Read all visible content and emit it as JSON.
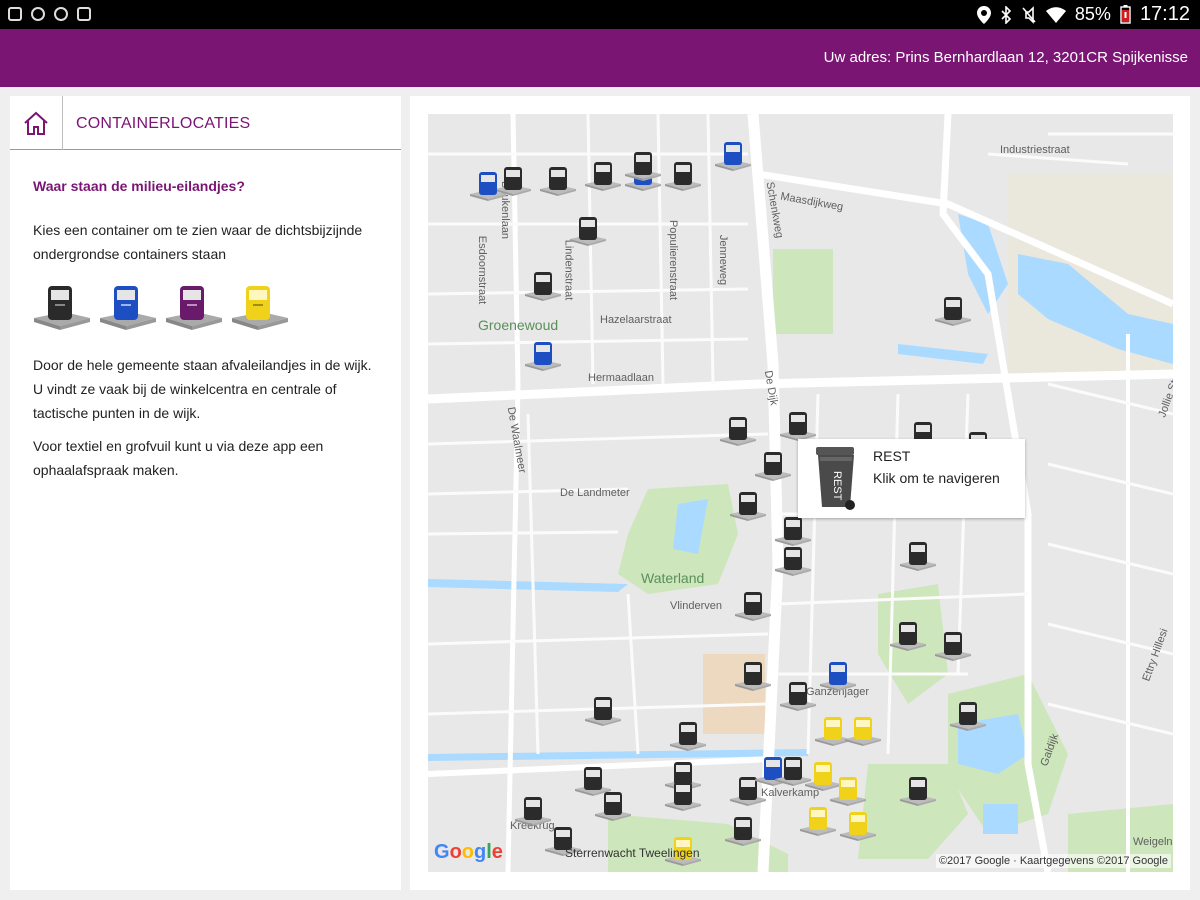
{
  "statusbar": {
    "battery": "85%",
    "time": "17:12",
    "left_icons": [
      "screenshot-icon",
      "settings-icon",
      "settings-icon",
      "gallery-icon"
    ],
    "right_icons": [
      "location-icon",
      "bluetooth-icon",
      "mute-icon",
      "wifi-icon",
      "battery-icon"
    ]
  },
  "header": {
    "address": "Uw adres: Prins Bernhardlaan 12, 3201CR Spijkenisse",
    "bar_color": "#7a1574"
  },
  "sidebar": {
    "home_icon": "home-icon",
    "title": "CONTAINERLOCATIES",
    "question": "Waar staan de milieu-eilandjes?",
    "intro": "Kies een container om te zien waar de dichtsbijzijnde ondergrondse containers staan",
    "containers": [
      {
        "type": "REST",
        "color": "#2a2a2a",
        "icon": "rest-container-icon"
      },
      {
        "type": "PAPIER",
        "color": "#1e4fc2",
        "icon": "paper-container-icon"
      },
      {
        "type": "PLASTIC",
        "color": "#6a1a6a",
        "icon": "plastic-container-icon"
      },
      {
        "type": "GLAS",
        "color": "#f1d21a",
        "icon": "glass-container-icon"
      }
    ],
    "paragraph1": "Door de hele gemeente staan afvaleilandjes in de wijk. U vindt ze vaak bij de winkelcentra en centrale of tactische punten in de wijk.",
    "paragraph2": "Voor textiel en grofvuil kunt u via deze app een ophaalafspraak maken."
  },
  "map": {
    "streets": [
      "Industriestraat",
      "Maasdijkweg",
      "Schenkweg",
      "Populierenstraat",
      "Jenneweg",
      "Lindenstraat",
      "Esdoornstraat",
      "Beukenlaan",
      "Hazelaarstraat",
      "Hermaadlaan",
      "De Waalmeer",
      "De Dijk",
      "De Landmeter",
      "Vlinderven",
      "Ganzenjager",
      "Kalverkamp",
      "Kreekrug",
      "Ettry Hillesi",
      "Galdijk",
      "Weigeln",
      "Jollie Straat"
    ],
    "areas": [
      "Groenewoud",
      "Waterland"
    ],
    "landmark": "Sterrenwacht Tweelingen",
    "google_logo": "Google",
    "copyright": "©2017 Google · Kaartgegevens ©2017 Google",
    "infowindow": {
      "title": "REST",
      "subtitle": "Klik om te navigeren",
      "icon": "rest-bin-icon"
    },
    "marker_types": {
      "rest": {
        "color": "#2b2b2b",
        "icon": "rest-marker-icon"
      },
      "paper": {
        "color": "#1e4fc2",
        "icon": "paper-marker-icon"
      },
      "glass": {
        "color": "#f1d21a",
        "icon": "glass-marker-icon"
      }
    }
  }
}
